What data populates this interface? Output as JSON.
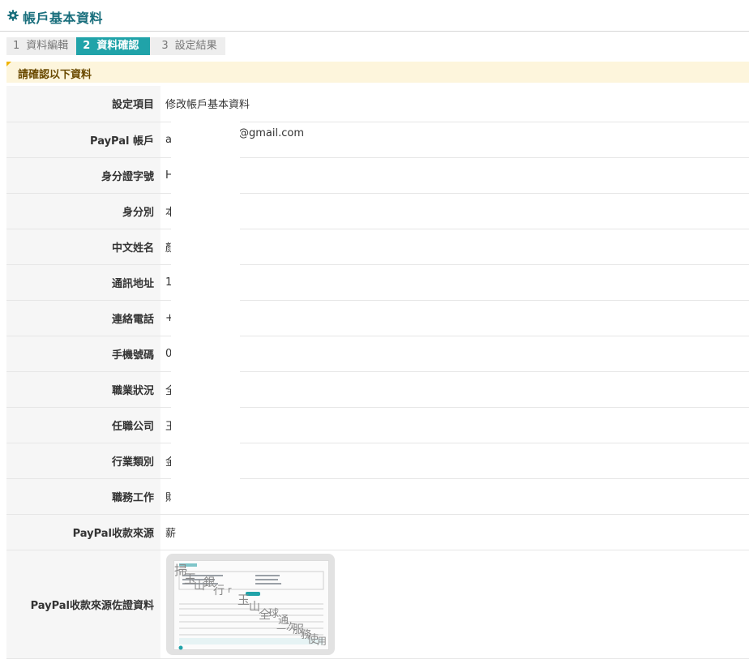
{
  "page": {
    "title": "帳戶基本資料",
    "title_icon": "gear-icon",
    "accent_color": "#1a6f7d"
  },
  "steps": [
    {
      "num": "1",
      "label": "資料編輯",
      "state": "inactive"
    },
    {
      "num": "2",
      "label": "資料確認",
      "state": "active"
    },
    {
      "num": "3",
      "label": "設定結果",
      "state": "inactive"
    }
  ],
  "confirm_banner": "請確認以下資料",
  "rows": [
    {
      "label": "設定項目",
      "value": "修改帳戶基本資料"
    },
    {
      "label": "PayPal 帳戶",
      "value": "a",
      "value_suffix": "@gmail.com"
    },
    {
      "label": "身分證字號",
      "value": "H"
    },
    {
      "label": "身分別",
      "value": "本"
    },
    {
      "label": "中文姓名",
      "value": "顏"
    },
    {
      "label": "通訊地址",
      "value": "1"
    },
    {
      "label": "連絡電話",
      "value": "+"
    },
    {
      "label": "手機號碼",
      "value": "0"
    },
    {
      "label": "職業狀況",
      "value": "全"
    },
    {
      "label": "任職公司",
      "value": "玉"
    },
    {
      "label": "行業類別",
      "value": "金"
    },
    {
      "label": "職務工作",
      "value": "財"
    },
    {
      "label": "PayPal收款來源",
      "value": "薪"
    },
    {
      "label": "PayPal收款來源佐證資料",
      "value": ""
    }
  ],
  "thumbnail_watermark": "掃玉山銀行 r 玉山全球通—次服務使用"
}
